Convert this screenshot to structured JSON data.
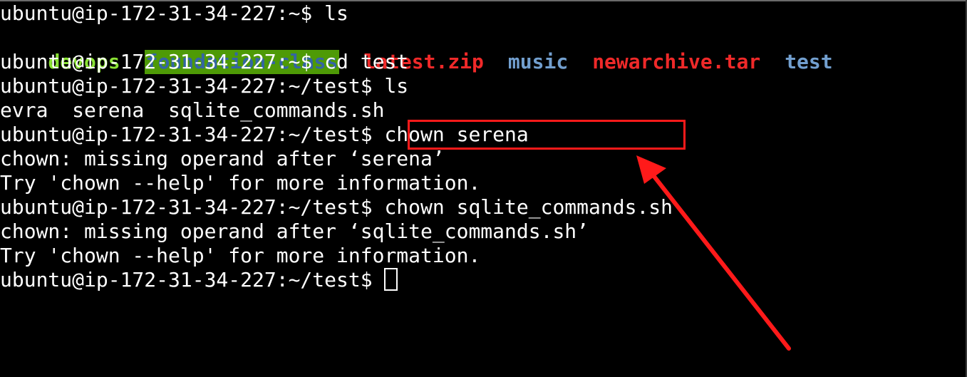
{
  "terminal": {
    "lines": {
      "l1": "ubuntu@ip-172-31-34-227:~$ ls",
      "l3": "ubuntu@ip-172-31-34-227:~$ cd test",
      "l4": "ubuntu@ip-172-31-34-227:~/test$ ls",
      "l5": "evra  serena  sqlite_commands.sh",
      "l6": "ubuntu@ip-172-31-34-227:~/test$ chown serena",
      "l7": "chown: missing operand after ‘serena’",
      "l8": "Try 'chown --help' for more information.",
      "l9": "ubuntu@ip-172-31-34-227:~/test$ chown sqlite_commands.sh",
      "l10": "chown: missing operand after ‘sqlite_commands.sh’",
      "l11": "Try 'chown --help' for more information.",
      "l12_prompt": "ubuntu@ip-172-31-34-227:~/test$ "
    },
    "ls_home": [
      {
        "name": "devops",
        "color": "#8ae234"
      },
      {
        "name": "foundation-class",
        "color": "#3465a4",
        "background": "#4e9a06"
      },
      {
        "name": "latest.zip",
        "color": "#ef2929"
      },
      {
        "name": "music",
        "color": "#729fcf"
      },
      {
        "name": "newarchive.tar",
        "color": "#ef2929"
      },
      {
        "name": "test",
        "color": "#729fcf"
      }
    ]
  },
  "annotation": {
    "color": "#ff1a1a",
    "highlight_target": "chown serena"
  },
  "colors": {
    "background": "#000000",
    "text": "#ffffff"
  }
}
